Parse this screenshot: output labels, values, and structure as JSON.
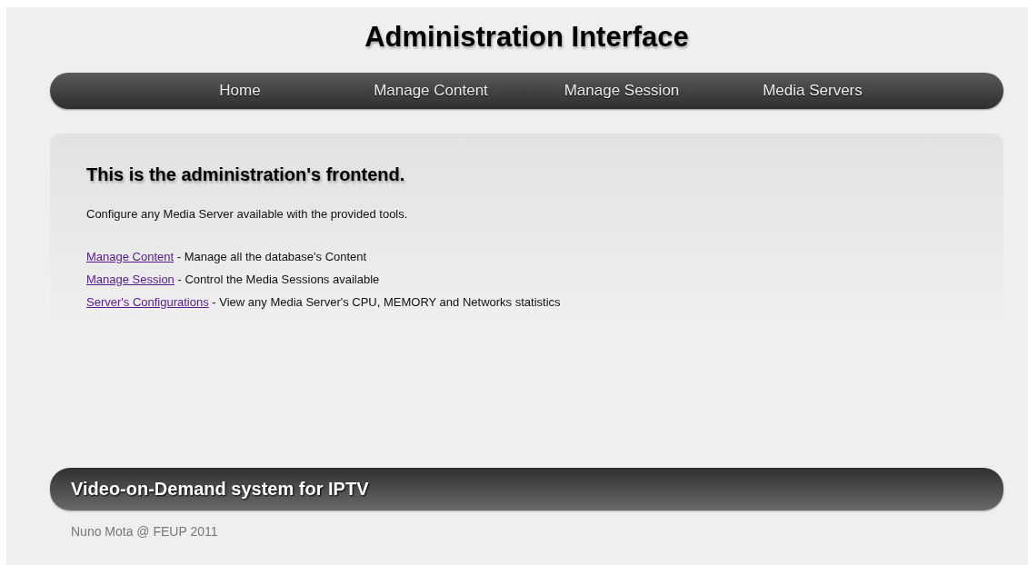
{
  "header": {
    "title": "Administration Interface"
  },
  "nav": [
    {
      "label": "Home"
    },
    {
      "label": "Manage Content"
    },
    {
      "label": "Manage Session"
    },
    {
      "label": "Media Servers"
    }
  ],
  "content": {
    "heading": "This is the administration's frontend.",
    "intro": "Configure any Media Server available with the provided tools.",
    "links": [
      {
        "link": "Manage Content",
        "description": " - Manage all the database's Content"
      },
      {
        "link": "Manage Session",
        "description": " - Control the Media Sessions available"
      },
      {
        "link": "Server's Configurations",
        "description": " - View any Media Server's CPU, MEMORY and Networks statistics"
      }
    ]
  },
  "footer": {
    "banner": "Video-on-Demand system for IPTV",
    "credit": "Nuno Mota @ FEUP 2011"
  }
}
